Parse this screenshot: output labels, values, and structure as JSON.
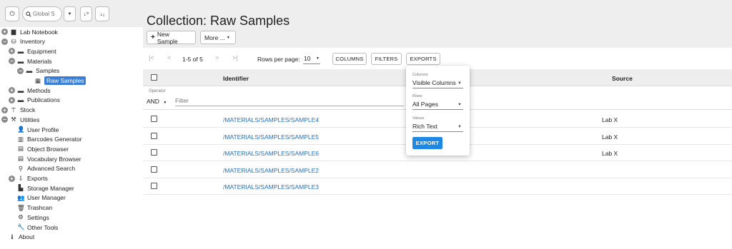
{
  "sidebar": {
    "search_placeholder": "Global S",
    "tree": [
      {
        "label": "Lab Notebook"
      },
      {
        "label": "Inventory"
      },
      {
        "label": "Equipment"
      },
      {
        "label": "Materials"
      },
      {
        "label": "Samples"
      },
      {
        "label": "Raw Samples"
      },
      {
        "label": "Methods"
      },
      {
        "label": "Publications"
      },
      {
        "label": "Stock"
      },
      {
        "label": "Utilities"
      },
      {
        "label": "User Profile"
      },
      {
        "label": "Barcodes Generator"
      },
      {
        "label": "Object Browser"
      },
      {
        "label": "Vocabulary Browser"
      },
      {
        "label": "Advanced Search"
      },
      {
        "label": "Exports"
      },
      {
        "label": "Storage Manager"
      },
      {
        "label": "User Manager"
      },
      {
        "label": "Trashcan"
      },
      {
        "label": "Settings"
      },
      {
        "label": "Other Tools"
      },
      {
        "label": "About"
      }
    ]
  },
  "header": {
    "title": "Collection: Raw Samples",
    "new_sample_label": "New Sample",
    "more_label": "More ..."
  },
  "pager": {
    "range": "1-5 of 5",
    "rows_per_page_label": "Rows per page:",
    "rows_per_page_value": "10",
    "columns_label": "COLUMNS",
    "filters_label": "FILTERS",
    "exports_label": "EXPORTS"
  },
  "table": {
    "headers": {
      "identifier": "Identifier",
      "source": "Source"
    },
    "filter": {
      "operator_label": "Operator",
      "operator_value": "AND",
      "placeholder": "Filter"
    },
    "rows": [
      {
        "identifier": "/MATERIALS/SAMPLES/SAMPLE4",
        "source": "Lab X"
      },
      {
        "identifier": "/MATERIALS/SAMPLES/SAMPLE5",
        "source": "Lab X"
      },
      {
        "identifier": "/MATERIALS/SAMPLES/SAMPLE6",
        "source": "Lab X"
      },
      {
        "identifier": "/MATERIALS/SAMPLES/SAMPLE2",
        "source": ""
      },
      {
        "identifier": "/MATERIALS/SAMPLES/SAMPLE3",
        "source": ""
      }
    ]
  },
  "export_popup": {
    "columns_label": "Columns",
    "columns_value": "Visible Columns",
    "rows_label": "Rows",
    "rows_value": "All Pages",
    "values_label": "Values",
    "values_value": "Rich Text",
    "export_label": "EXPORT"
  },
  "colors": {
    "accent": "#1e88e5",
    "selected": "#3a7fd5",
    "link": "#2a6fc2",
    "header_bg": "#eeeeee"
  }
}
